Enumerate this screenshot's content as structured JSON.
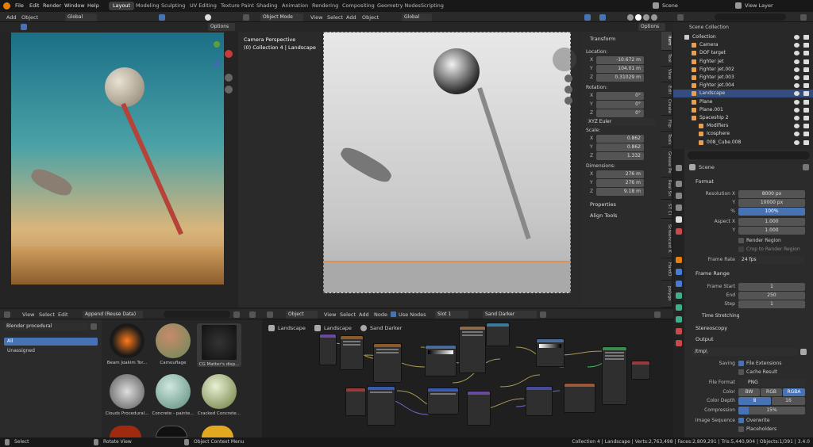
{
  "menu": {
    "items": [
      "File",
      "Edit",
      "Render",
      "Window",
      "Help"
    ]
  },
  "workspaces": [
    "Layout",
    "Modeling",
    "Sculpting",
    "UV Editing",
    "Texture Paint",
    "Shading",
    "Animation",
    "Rendering",
    "Compositing",
    "Geometry Nodes",
    "Scripting"
  ],
  "active_workspace": "Layout",
  "scene_name": "Scene",
  "view_layer": "View Layer",
  "left_viewport": {
    "add": "Add",
    "object": "Object",
    "orientation": "Global",
    "options": "Options"
  },
  "main_viewport": {
    "mode": "Object Mode",
    "view": "View",
    "select": "Select",
    "add": "Add",
    "object": "Object",
    "orientation": "Global",
    "options": "Options",
    "overlay_title": "Camera Perspective",
    "overlay_sub": "(0) Collection 4 | Landscape"
  },
  "n_panel": {
    "transform": "Transform",
    "location": "Location:",
    "loc": [
      {
        "k": "X",
        "v": "-10.672 m"
      },
      {
        "k": "Y",
        "v": "104.01 m"
      },
      {
        "k": "Z",
        "v": "0.31029 m"
      }
    ],
    "rotation": "Rotation:",
    "rot": [
      {
        "k": "X",
        "v": "0°"
      },
      {
        "k": "Y",
        "v": "0°"
      },
      {
        "k": "Z",
        "v": "0°"
      }
    ],
    "euler": "XYZ Euler",
    "scale": "Scale:",
    "scl": [
      {
        "k": "X",
        "v": "0.862"
      },
      {
        "k": "Y",
        "v": "0.862"
      },
      {
        "k": "Z",
        "v": "1.332"
      }
    ],
    "dimensions": "Dimensions:",
    "dim": [
      {
        "k": "X",
        "v": "276 m"
      },
      {
        "k": "Y",
        "v": "276 m"
      },
      {
        "k": "Z",
        "v": "9.18 m"
      }
    ],
    "properties": "Properties",
    "align_tools": "Align Tools"
  },
  "side_tabs": [
    "Item",
    "Tool",
    "View",
    "Edit",
    "Create",
    "Flip",
    "Tools",
    "Grease Pe",
    "Real Sn",
    "ST Cl",
    "Screencast K",
    "HardO",
    "polygo"
  ],
  "outliner": {
    "root": "Scene Collection",
    "items": [
      {
        "name": "Collection",
        "indent": 0
      },
      {
        "name": "Camera",
        "indent": 1
      },
      {
        "name": "DOF target",
        "indent": 1
      },
      {
        "name": "Fighter jet",
        "indent": 1
      },
      {
        "name": "Fighter jet.002",
        "indent": 1
      },
      {
        "name": "Fighter jet.003",
        "indent": 1
      },
      {
        "name": "Fighter jet.004",
        "indent": 1
      },
      {
        "name": "Landscape",
        "indent": 1,
        "selected": true
      },
      {
        "name": "Plane",
        "indent": 1
      },
      {
        "name": "Plane.001",
        "indent": 1
      },
      {
        "name": "SpaceshIp 2",
        "indent": 1
      },
      {
        "name": "Modifiers",
        "indent": 2
      },
      {
        "name": "Icosphere",
        "indent": 2
      },
      {
        "name": "008_Cube.008",
        "indent": 2
      }
    ]
  },
  "properties": {
    "context": "Scene",
    "format": "Format",
    "resolution_x_label": "Resolution X",
    "resolution_x": "8000 px",
    "y_label": "Y",
    "resolution_y": "10000 px",
    "pct_label": "%",
    "pct": "100%",
    "aspect_x_label": "Aspect X",
    "aspect_x": "1.000",
    "aspect_y_label": "Y",
    "aspect_y": "1.000",
    "render_region": "Render Region",
    "crop_region": "Crop to Render Region",
    "frame_rate_label": "Frame Rate",
    "frame_rate": "24 fps",
    "frame_range": "Frame Range",
    "frame_start_label": "Frame Start",
    "frame_start": "1",
    "end_label": "End",
    "frame_end": "250",
    "step_label": "Step",
    "frame_step": "1",
    "time_stretching": "Time Stretching",
    "stereoscopy": "Stereoscopy",
    "output": "Output",
    "output_path": "/tmp\\",
    "saving_label": "Saving",
    "file_extensions": "File Extensions",
    "cache_result": "Cache Result",
    "file_format_label": "File Format",
    "file_format": "PNG",
    "color_label": "Color",
    "color_opts": [
      "BW",
      "RGB",
      "RGBA"
    ],
    "color_selected": "RGBA",
    "depth_label": "Color Depth",
    "depth_opts": [
      "8",
      "16"
    ],
    "depth_selected": "8",
    "compression_label": "Compression",
    "compression": "15%",
    "compression_value": 0.15,
    "image_seq_label": "Image Sequence",
    "overwrite": "Overwrite",
    "placeholders": "Placeholders"
  },
  "asset_browser": {
    "view": "View",
    "select": "Select",
    "edit": "Edit",
    "import_mode": "Append (Reuse Data)",
    "library": "Blender procedural",
    "catalogs": [
      "All",
      "Unassigned"
    ],
    "assets": [
      "Beam Joakim Tor...",
      "Camouflage",
      "CG Matter's disp...",
      "Clouds Procedural...",
      "Concrete - painte...",
      "Cracked Concrete..."
    ]
  },
  "node_editor": {
    "object": "Object",
    "view": "View",
    "select": "Select",
    "add": "Add",
    "node": "Node",
    "use_nodes": "Use Nodes",
    "slot": "Slot 1",
    "material": "Sand Darker",
    "breadcrumb": [
      "Landscape",
      "Landscape",
      "Sand Darker"
    ]
  },
  "statusbar": {
    "select": "Select",
    "rotate": "Rotate View",
    "context": "Object Context Menu",
    "stats": "Collection 4 | Landscape | Verts:2,763,498 | Faces:2,809,291 | Tris:5,440,904 | Objects:1/391 | 3.4.0"
  }
}
